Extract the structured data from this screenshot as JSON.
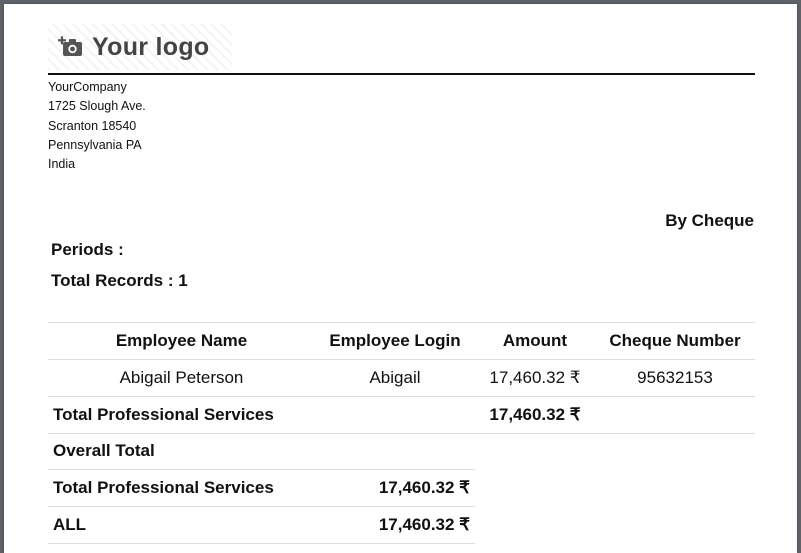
{
  "logo": {
    "text": "Your logo",
    "icon": "camera-plus-icon"
  },
  "company": {
    "name": "YourCompany",
    "street": "1725 Slough Ave.",
    "city_zip": "Scranton 18540",
    "state_country_line": "Pennsylvania PA",
    "country": "India"
  },
  "report": {
    "payment_mode": "By Cheque",
    "periods_label": "Periods :",
    "total_records_label": "Total Records : 1"
  },
  "table": {
    "headers": [
      "Employee Name",
      "Employee Login",
      "Amount",
      "Cheque Number"
    ],
    "rows": [
      {
        "name": "Abigail Peterson",
        "login": "Abigail",
        "amount": "17,460.32 ₹",
        "cheque": "95632153"
      }
    ],
    "group_total": {
      "label": "Total Professional Services",
      "amount": "17,460.32 ₹"
    }
  },
  "overall": {
    "title": "Overall Total",
    "rows": [
      {
        "label": "Total Professional Services",
        "amount": "17,460.32 ₹"
      },
      {
        "label": "ALL",
        "amount": "17,460.32 ₹"
      }
    ]
  }
}
